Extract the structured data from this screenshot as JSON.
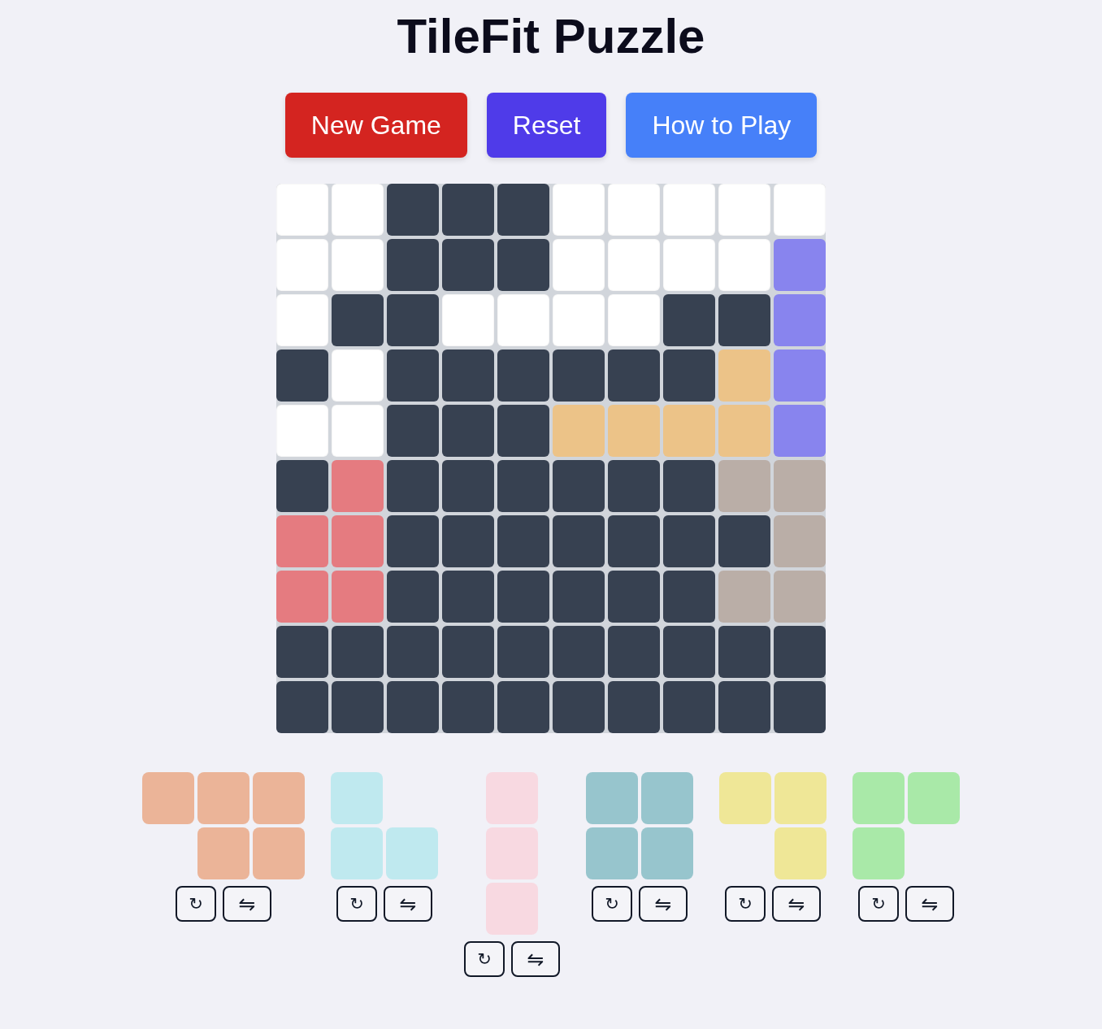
{
  "title": "TileFit Puzzle",
  "actions": [
    {
      "kind": "new_game",
      "label": "New Game"
    },
    {
      "kind": "reset",
      "label": "Reset"
    },
    {
      "kind": "help",
      "label": "How to Play"
    }
  ],
  "board": {
    "rows": [
      {
        "cells": [
          {
            "kind": "empty"
          },
          {
            "kind": "empty"
          },
          {
            "kind": "blocked"
          },
          {
            "kind": "blocked"
          },
          {
            "kind": "blocked"
          },
          {
            "kind": "empty"
          },
          {
            "kind": "empty"
          },
          {
            "kind": "empty"
          },
          {
            "kind": "empty"
          },
          {
            "kind": "empty"
          }
        ]
      },
      {
        "cells": [
          {
            "kind": "empty"
          },
          {
            "kind": "empty"
          },
          {
            "kind": "blocked"
          },
          {
            "kind": "blocked"
          },
          {
            "kind": "blocked"
          },
          {
            "kind": "empty"
          },
          {
            "kind": "empty"
          },
          {
            "kind": "empty"
          },
          {
            "kind": "empty"
          },
          {
            "kind": "piece",
            "color": "#8884ee"
          }
        ]
      },
      {
        "cells": [
          {
            "kind": "empty"
          },
          {
            "kind": "blocked"
          },
          {
            "kind": "blocked"
          },
          {
            "kind": "empty"
          },
          {
            "kind": "empty"
          },
          {
            "kind": "empty"
          },
          {
            "kind": "empty"
          },
          {
            "kind": "blocked"
          },
          {
            "kind": "blocked"
          },
          {
            "kind": "piece",
            "color": "#8884ee"
          }
        ]
      },
      {
        "cells": [
          {
            "kind": "blocked"
          },
          {
            "kind": "empty"
          },
          {
            "kind": "blocked"
          },
          {
            "kind": "blocked"
          },
          {
            "kind": "blocked"
          },
          {
            "kind": "blocked"
          },
          {
            "kind": "blocked"
          },
          {
            "kind": "blocked"
          },
          {
            "kind": "piece",
            "color": "#ecc388"
          },
          {
            "kind": "piece",
            "color": "#8884ee"
          }
        ]
      },
      {
        "cells": [
          {
            "kind": "empty"
          },
          {
            "kind": "empty"
          },
          {
            "kind": "blocked"
          },
          {
            "kind": "blocked"
          },
          {
            "kind": "blocked"
          },
          {
            "kind": "piece",
            "color": "#ecc388"
          },
          {
            "kind": "piece",
            "color": "#ecc388"
          },
          {
            "kind": "piece",
            "color": "#ecc388"
          },
          {
            "kind": "piece",
            "color": "#ecc388"
          },
          {
            "kind": "piece",
            "color": "#8884ee"
          }
        ]
      },
      {
        "cells": [
          {
            "kind": "blocked"
          },
          {
            "kind": "piece",
            "color": "#e57b80"
          },
          {
            "kind": "blocked"
          },
          {
            "kind": "blocked"
          },
          {
            "kind": "blocked"
          },
          {
            "kind": "blocked"
          },
          {
            "kind": "blocked"
          },
          {
            "kind": "blocked"
          },
          {
            "kind": "piece",
            "color": "#baaea7"
          },
          {
            "kind": "piece",
            "color": "#baaea7"
          }
        ]
      },
      {
        "cells": [
          {
            "kind": "piece",
            "color": "#e57b80"
          },
          {
            "kind": "piece",
            "color": "#e57b80"
          },
          {
            "kind": "blocked"
          },
          {
            "kind": "blocked"
          },
          {
            "kind": "blocked"
          },
          {
            "kind": "blocked"
          },
          {
            "kind": "blocked"
          },
          {
            "kind": "blocked"
          },
          {
            "kind": "blocked"
          },
          {
            "kind": "piece",
            "color": "#baaea7"
          }
        ]
      },
      {
        "cells": [
          {
            "kind": "piece",
            "color": "#e57b80"
          },
          {
            "kind": "piece",
            "color": "#e57b80"
          },
          {
            "kind": "blocked"
          },
          {
            "kind": "blocked"
          },
          {
            "kind": "blocked"
          },
          {
            "kind": "blocked"
          },
          {
            "kind": "blocked"
          },
          {
            "kind": "blocked"
          },
          {
            "kind": "piece",
            "color": "#baaea7"
          },
          {
            "kind": "piece",
            "color": "#baaea7"
          }
        ]
      },
      {
        "cells": [
          {
            "kind": "blocked"
          },
          {
            "kind": "blocked"
          },
          {
            "kind": "blocked"
          },
          {
            "kind": "blocked"
          },
          {
            "kind": "blocked"
          },
          {
            "kind": "blocked"
          },
          {
            "kind": "blocked"
          },
          {
            "kind": "blocked"
          },
          {
            "kind": "blocked"
          },
          {
            "kind": "blocked"
          }
        ]
      },
      {
        "cells": [
          {
            "kind": "blocked"
          },
          {
            "kind": "blocked"
          },
          {
            "kind": "blocked"
          },
          {
            "kind": "blocked"
          },
          {
            "kind": "blocked"
          },
          {
            "kind": "blocked"
          },
          {
            "kind": "blocked"
          },
          {
            "kind": "blocked"
          },
          {
            "kind": "blocked"
          },
          {
            "kind": "blocked"
          }
        ]
      }
    ]
  },
  "pieces": [
    {
      "color": "#ebb498",
      "rows": [
        {
          "cells": [
            {
              "filled": true
            },
            {
              "filled": true
            },
            {
              "filled": true
            }
          ]
        },
        {
          "cells": [
            {
              "filled": false
            },
            {
              "filled": true
            },
            {
              "filled": true
            }
          ]
        }
      ],
      "buttons": [
        {
          "kind": "rotate",
          "label": "↻"
        },
        {
          "kind": "flip",
          "label": "⇋"
        }
      ]
    },
    {
      "color": "#bfe9ef",
      "rows": [
        {
          "cells": [
            {
              "filled": true
            },
            {
              "filled": false
            }
          ]
        },
        {
          "cells": [
            {
              "filled": true
            },
            {
              "filled": true
            }
          ]
        }
      ],
      "buttons": [
        {
          "kind": "rotate",
          "label": "↻"
        },
        {
          "kind": "flip",
          "label": "⇋"
        }
      ]
    },
    {
      "color": "#f8d9e1",
      "rows": [
        {
          "cells": [
            {
              "filled": true
            }
          ]
        },
        {
          "cells": [
            {
              "filled": true
            }
          ]
        },
        {
          "cells": [
            {
              "filled": true
            }
          ]
        }
      ],
      "buttons": [
        {
          "kind": "rotate",
          "label": "↻"
        },
        {
          "kind": "flip",
          "label": "⇋"
        }
      ]
    },
    {
      "color": "#97c5cd",
      "rows": [
        {
          "cells": [
            {
              "filled": true
            },
            {
              "filled": true
            }
          ]
        },
        {
          "cells": [
            {
              "filled": true
            },
            {
              "filled": true
            }
          ]
        }
      ],
      "buttons": [
        {
          "kind": "rotate",
          "label": "↻"
        },
        {
          "kind": "flip",
          "label": "⇋"
        }
      ]
    },
    {
      "color": "#efe797",
      "rows": [
        {
          "cells": [
            {
              "filled": true
            },
            {
              "filled": true
            }
          ]
        },
        {
          "cells": [
            {
              "filled": false
            },
            {
              "filled": true
            }
          ]
        }
      ],
      "buttons": [
        {
          "kind": "rotate",
          "label": "↻"
        },
        {
          "kind": "flip",
          "label": "⇋"
        }
      ]
    },
    {
      "color": "#a9e9a8",
      "rows": [
        {
          "cells": [
            {
              "filled": true
            },
            {
              "filled": true
            }
          ]
        },
        {
          "cells": [
            {
              "filled": true
            },
            {
              "filled": false
            }
          ]
        }
      ],
      "buttons": [
        {
          "kind": "rotate",
          "label": "↻"
        },
        {
          "kind": "flip",
          "label": "⇋"
        }
      ]
    }
  ]
}
